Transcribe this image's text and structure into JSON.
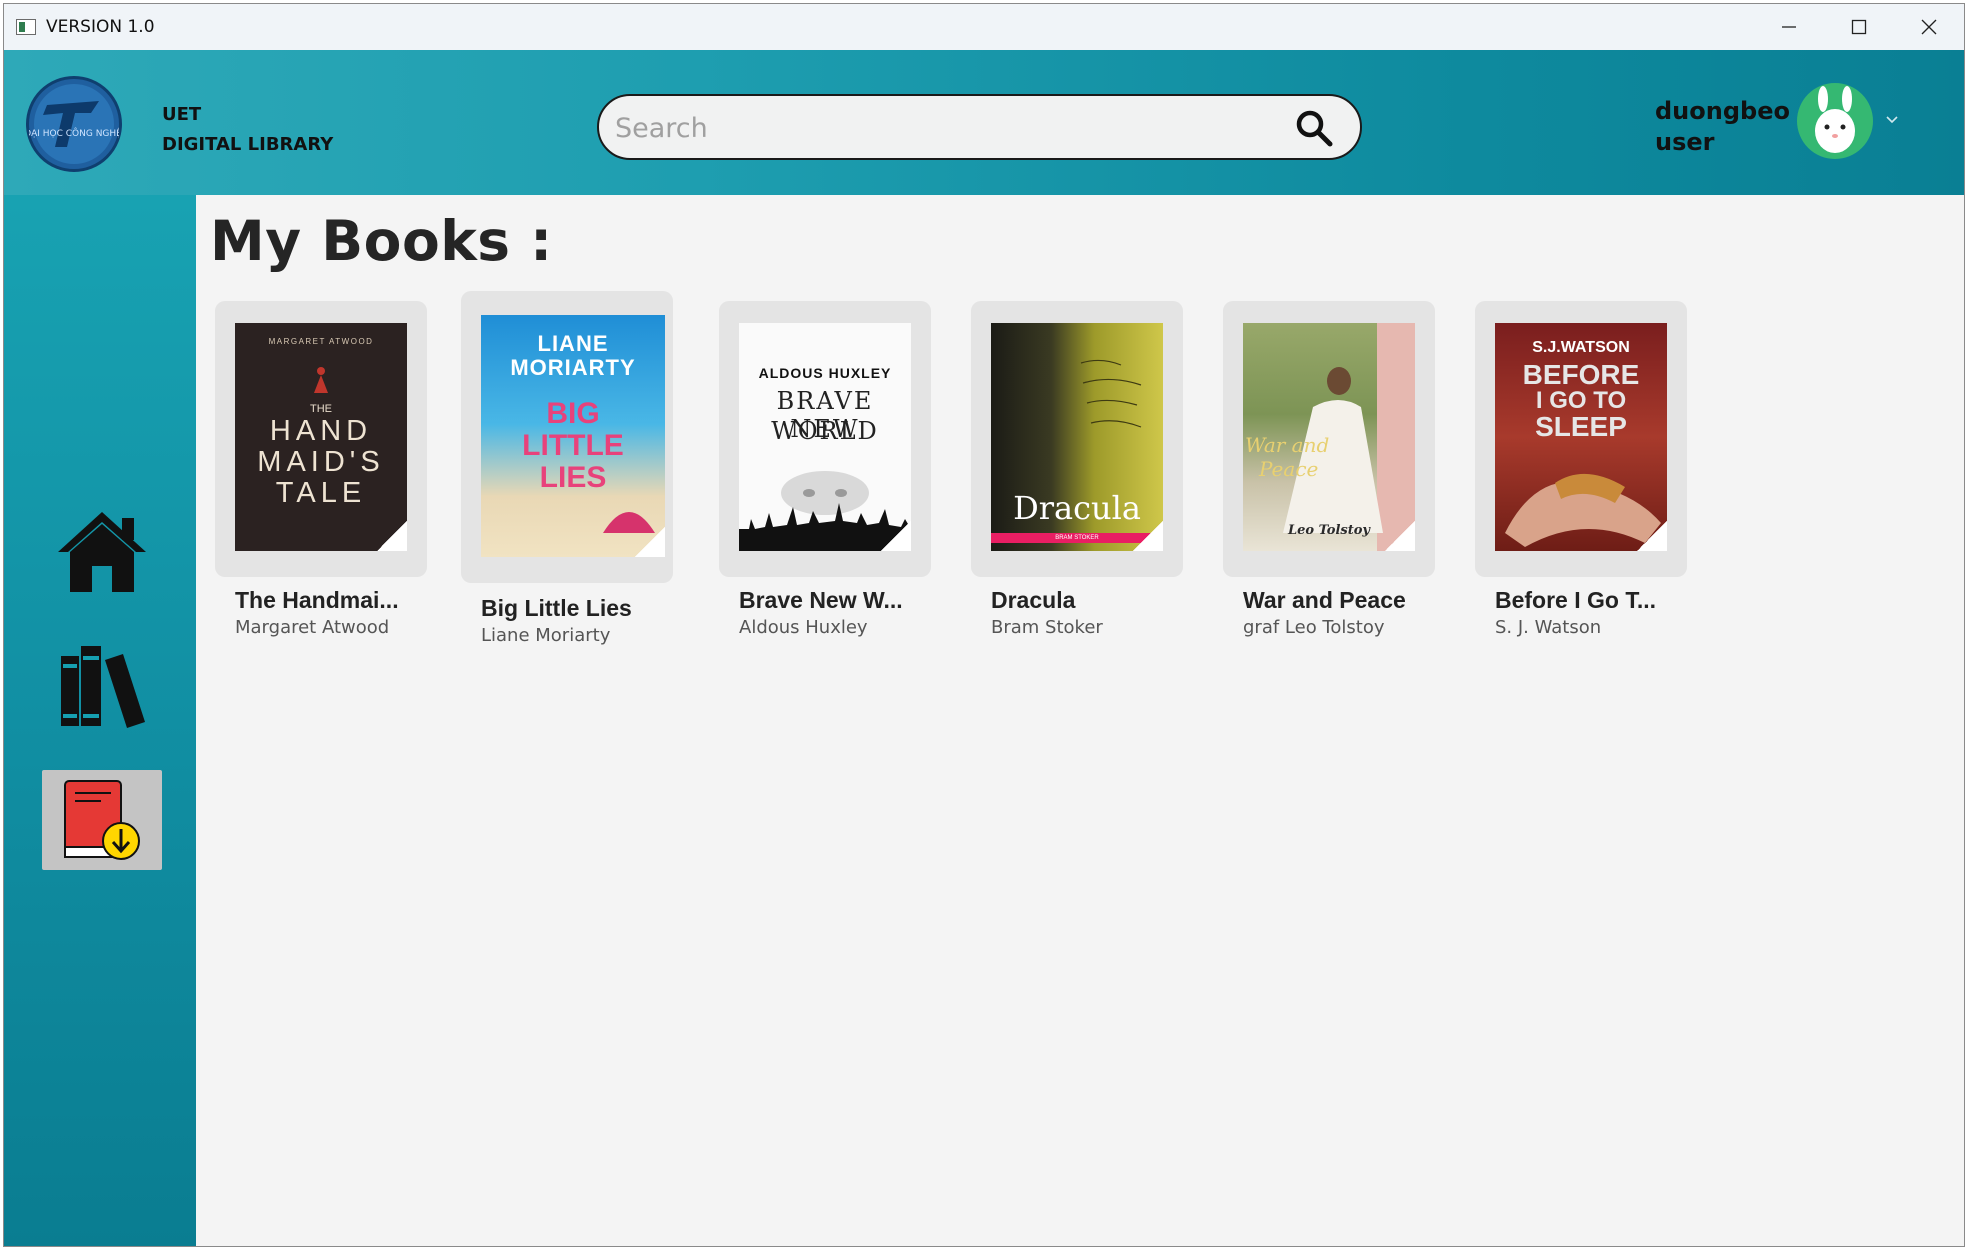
{
  "window": {
    "title": "VERSION 1.0"
  },
  "header": {
    "brand_line1": "UET",
    "brand_line2": "DIGITAL LIBRARY",
    "logo_text": "ĐẠI HỌC CÔNG NGHỆ",
    "search_placeholder": "Search",
    "user_name": "duongbeo",
    "user_role": "user"
  },
  "sidebar": {
    "items": [
      {
        "name": "home",
        "icon": "home-icon"
      },
      {
        "name": "library",
        "icon": "books-icon"
      },
      {
        "name": "my-books",
        "icon": "book-download-icon",
        "active": true
      }
    ]
  },
  "main": {
    "title": "My Books :",
    "books": [
      {
        "title": "The Handmai...",
        "author": "Margaret Atwood",
        "cover_author": "MARGARET ATWOOD",
        "cover_line1": "THE",
        "cover_line2": "HAND",
        "cover_line3": "MAID'S",
        "cover_line4": "TALE"
      },
      {
        "title": "Big Little Lies",
        "author": "Liane Moriarty",
        "cover_author1": "LIANE",
        "cover_author2": "MORIARTY",
        "cover_line1": "BIG",
        "cover_line2": "LITTLE",
        "cover_line3": "LIES"
      },
      {
        "title": "Brave New W...",
        "author": "Aldous Huxley",
        "cover_author": "ALDOUS HUXLEY",
        "cover_line1": "BRAVE NEW",
        "cover_line2": "WORLD"
      },
      {
        "title": "Dracula",
        "author": "Bram Stoker",
        "cover_line1": "Dracula",
        "cover_sub": "BRAM STOKER"
      },
      {
        "title": "War and Peace",
        "author": "graf Leo Tolstoy",
        "cover_line1": "War and",
        "cover_line2": "Peace",
        "cover_author": "Leo Tolstoy"
      },
      {
        "title": "Before I Go T...",
        "author": "S. J. Watson",
        "cover_author": "S.J.WATSON",
        "cover_line1": "BEFORE",
        "cover_line2": "I GO TO",
        "cover_line3": "SLEEP"
      }
    ]
  },
  "colors": {
    "header_start": "#2ea9b8",
    "header_end": "#0a7f94",
    "sidebar": "#118fa3",
    "background": "#f4f4f4"
  }
}
